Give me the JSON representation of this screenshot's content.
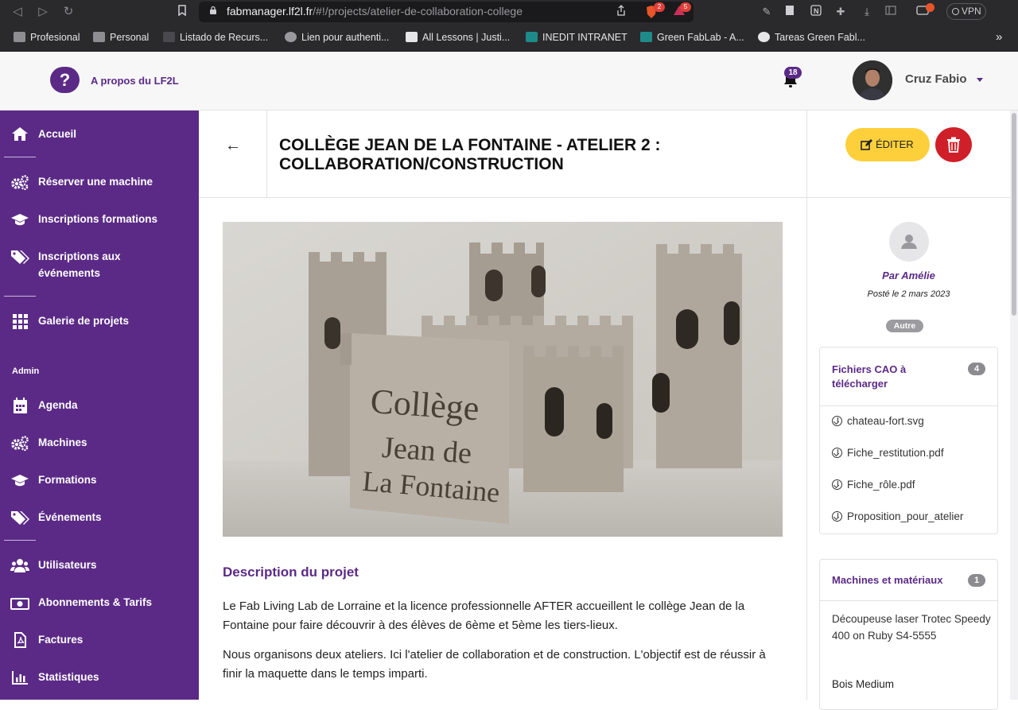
{
  "browser": {
    "url_host": "fabmanager.lf2l.fr",
    "url_path": "/#!/projects/atelier-de-collaboration-college",
    "shield_count": "2",
    "alert_count": "5",
    "vpn_label": "VPN",
    "bookmarks": [
      {
        "label": "Profesional",
        "color": "#8e8e92"
      },
      {
        "label": "Personal",
        "color": "#8e8e92"
      },
      {
        "label": "Listado de Recurs...",
        "color": "#4a4a4e"
      },
      {
        "label": "Lien pour authenti...",
        "color": "#9a9a9e"
      },
      {
        "label": "All Lessons | Justi...",
        "color": "#e6e6e8"
      },
      {
        "label": "INEDIT INTRANET",
        "color": "#1e8a8a"
      },
      {
        "label": "Green FabLab - A...",
        "color": "#1e8a8a"
      },
      {
        "label": "Tareas Green Fabl...",
        "color": "#e6e6e8"
      }
    ],
    "more_bookmarks": "»"
  },
  "header": {
    "help_icon": "?",
    "help_label": "A propos du LF2L",
    "notifications_count": "18",
    "user_name": "Cruz Fabio"
  },
  "sidebar": {
    "items": [
      {
        "label": "Accueil",
        "icon": "home-icon"
      },
      {
        "label": "Réserver une machine",
        "icon": "gears-icon"
      },
      {
        "label": "Inscriptions formations",
        "icon": "graduation-cap-icon"
      },
      {
        "label": "Inscriptions aux\névénements",
        "icon": "tags-icon"
      },
      {
        "label": "Galerie de projets",
        "icon": "grid-icon"
      }
    ],
    "admin_label": "Admin",
    "admin_items": [
      {
        "label": "Agenda",
        "icon": "calendar-icon"
      },
      {
        "label": "Machines",
        "icon": "gears-icon"
      },
      {
        "label": "Formations",
        "icon": "graduation-cap-icon"
      },
      {
        "label": "Événements",
        "icon": "tags-icon"
      },
      {
        "label": "Utilisateurs",
        "icon": "users-icon"
      },
      {
        "label": "Abonnements & Tarifs",
        "icon": "money-icon"
      },
      {
        "label": "Factures",
        "icon": "file-pdf-icon"
      },
      {
        "label": "Statistiques",
        "icon": "bar-chart-icon"
      }
    ]
  },
  "project": {
    "back_arrow": "←",
    "title": "COLLÈGE JEAN DE LA FONTAINE - ATELIER 2 : COLLABORATION/CONSTRUCTION",
    "edit_label": "ÉDITER",
    "image_text": [
      "Collège",
      "Jean de",
      "La Fontaine"
    ],
    "description_title": "Description du projet",
    "description_paragraphs": [
      "Le Fab Living Lab de Lorraine et la licence professionnelle AFTER accueillent le collège Jean de la Fontaine pour faire découvrir à des élèves de 6ème et 5ème les tiers-lieux.",
      "Nous organisons deux ateliers. Ici l'atelier de collaboration et de construction. L'objectif est de réussir à finir la maquette dans le temps imparti."
    ]
  },
  "right_panel": {
    "author": "Par Amélie",
    "posted": "Posté le 2 mars 2023",
    "tag": "Autre",
    "cao": {
      "title": "Fichiers CAO à télécharger",
      "count": "4",
      "files": [
        "chateau-fort.svg",
        "Fiche_restitution.pdf",
        "Fiche_rôle.pdf",
        "Proposition_pour_atelier"
      ]
    },
    "machines": {
      "title": "Machines et matériaux",
      "count": "1",
      "machine": "Découpeuse laser Trotec Speedy 400 on Ruby S4-5555",
      "material": "Bois Medium"
    }
  },
  "colors": {
    "brand_purple": "#5b2a86",
    "edit_yellow": "#fdd03b",
    "delete_red": "#cf1f28"
  }
}
